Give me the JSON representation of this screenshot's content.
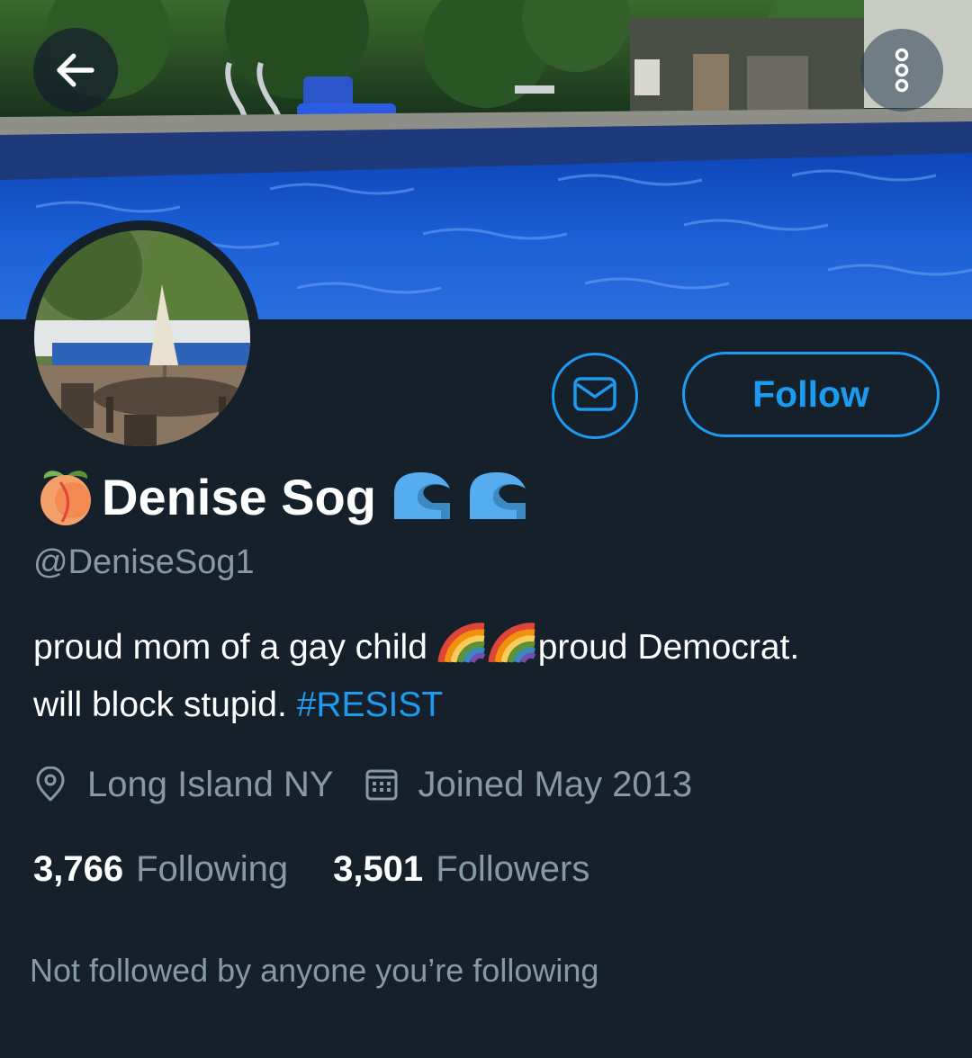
{
  "header": {
    "back_icon": "arrow-left-icon",
    "more_icon": "more-vertical-icon"
  },
  "actions": {
    "message_icon": "envelope-icon",
    "follow_label": "Follow"
  },
  "profile": {
    "name_prefix_emoji": "peach-emoji",
    "display_name": "Denise Sog",
    "name_suffix_emoji": "wave-emoji-x2",
    "handle": "@DeniseSog1",
    "bio_line1_a": "proud mom of a gay child ",
    "bio_emoji": "rainbow-emoji-x2",
    "bio_line1_b": "proud Democrat.",
    "bio_line2": "will block stupid. ",
    "bio_hashtag": "#RESIST",
    "location": "Long Island NY",
    "location_icon": "location-pin-icon",
    "joined": "Joined May 2013",
    "joined_icon": "calendar-icon",
    "following_count": "3,766",
    "following_label": "Following",
    "followers_count": "3,501",
    "followers_label": "Followers",
    "mutuals_note": "Not followed by anyone you’re following"
  },
  "colors": {
    "background": "#15202b",
    "accent": "#1d9bf0",
    "secondary_text": "#8899a6",
    "primary_text": "#ffffff"
  }
}
